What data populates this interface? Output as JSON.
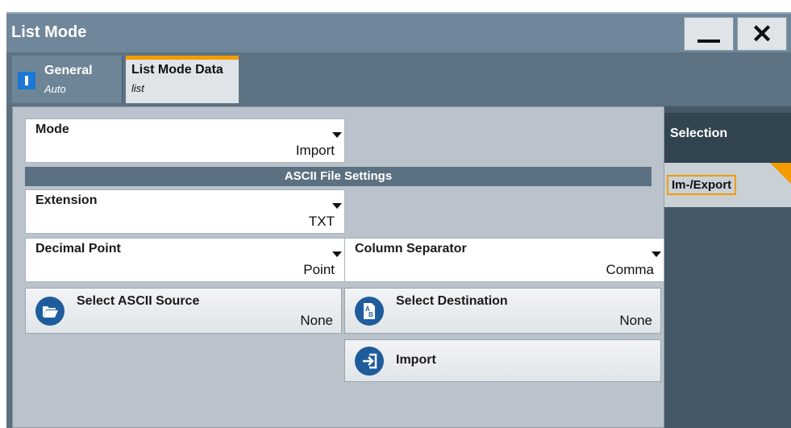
{
  "window": {
    "title": "List Mode",
    "minimize_icon": "minimize-icon",
    "close_icon": "close-icon",
    "close_glyph": "✕"
  },
  "tabs": [
    {
      "label": "General",
      "sublabel": "Auto",
      "icon": "toggle-switch-icon",
      "active": false
    },
    {
      "label": "List Mode Data",
      "sublabel": "list",
      "active": true
    }
  ],
  "form": {
    "mode": {
      "label": "Mode",
      "value": "Import"
    },
    "section_title": "ASCII File Settings",
    "extension": {
      "label": "Extension",
      "value": "TXT"
    },
    "decimal_point": {
      "label": "Decimal Point",
      "value": "Point"
    },
    "column_separator": {
      "label": "Column Separator",
      "value": "Comma"
    },
    "select_source": {
      "label": "Select ASCII Source",
      "value": "None",
      "icon": "folder-open-icon"
    },
    "select_destination": {
      "label": "Select Destination",
      "value": "None",
      "icon": "file-ab-icon"
    },
    "import_button": {
      "label": "Import",
      "icon": "import-arrow-icon"
    }
  },
  "side_nav": {
    "items": [
      {
        "label": "Selection",
        "active": false
      },
      {
        "label": "Im-/Export",
        "active": true
      }
    ]
  },
  "colors": {
    "accent": "#f59a00",
    "button_icon_bg": "#1f5c9c",
    "toggle_blue": "#1a78d4"
  }
}
